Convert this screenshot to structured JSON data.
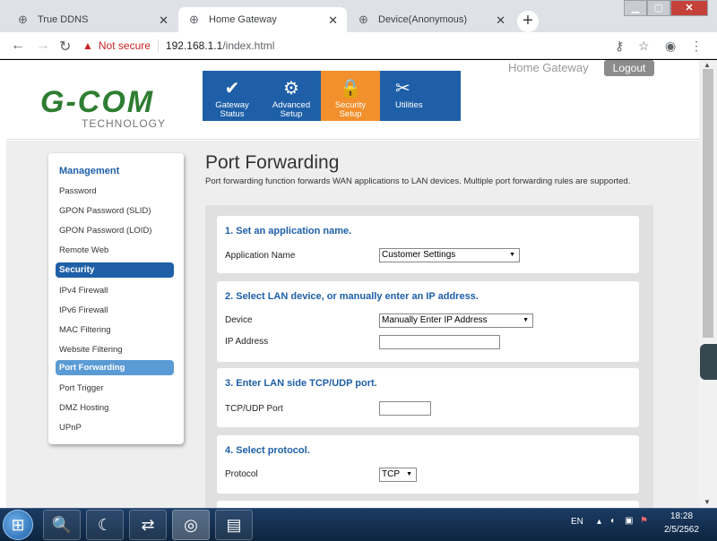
{
  "browser": {
    "tabs": [
      {
        "title": "True DDNS",
        "active": false
      },
      {
        "title": "Home Gateway",
        "active": true
      },
      {
        "title": "Device(Anonymous)",
        "active": false
      }
    ],
    "security_label": "Not secure",
    "url_host": "192.168.1.1",
    "url_path": "/index.html",
    "window_buttons": [
      "minimize-icon",
      "maximize-icon",
      "close-icon"
    ]
  },
  "header": {
    "logo_main": "G-COM",
    "logo_sub": "TECHNOLOGY",
    "title": "Home Gateway",
    "logout": "Logout",
    "nav": [
      {
        "line1": "Gateway",
        "line2": "Status",
        "icon": "check-circle-icon",
        "active": false
      },
      {
        "line1": "Advanced",
        "line2": "Setup",
        "icon": "gear-icon",
        "active": false
      },
      {
        "line1": "Security",
        "line2": "Setup",
        "icon": "lock-icon",
        "active": true
      },
      {
        "line1": "Utilities",
        "line2": "",
        "icon": "tools-icon",
        "active": false
      }
    ]
  },
  "sidebar": {
    "management_title": "Management",
    "management_items": [
      "Password",
      "GPON Password (SLID)",
      "GPON Password (LOID)",
      "Remote Web"
    ],
    "security_title": "Security",
    "security_items": [
      "IPv4 Firewall",
      "IPv6 Firewall",
      "MAC Filtering",
      "Website Filtering",
      "Port Forwarding",
      "Port Trigger",
      "DMZ Hosting",
      "UPnP"
    ],
    "selected": "Port Forwarding"
  },
  "main": {
    "title": "Port Forwarding",
    "description": "Port forwarding function forwards WAN applications to LAN devices. Multiple port forwarding rules are supported.",
    "step1": {
      "heading": "1. Set an application name.",
      "label": "Application Name",
      "value": "Customer Settings"
    },
    "step2": {
      "heading": "2. Select LAN device, or manually enter an IP address.",
      "device_label": "Device",
      "device_value": "Manually Enter IP Address",
      "ip_label": "IP Address",
      "ip_value": ""
    },
    "step3": {
      "heading": "3. Enter LAN side TCP/UDP port.",
      "label": "TCP/UDP Port",
      "value": ""
    },
    "step4": {
      "heading": "4. Select protocol.",
      "label": "Protocol",
      "value": "TCP"
    }
  },
  "taskbar": {
    "language": "EN",
    "time": "18:28",
    "date": "2/5/2562"
  }
}
